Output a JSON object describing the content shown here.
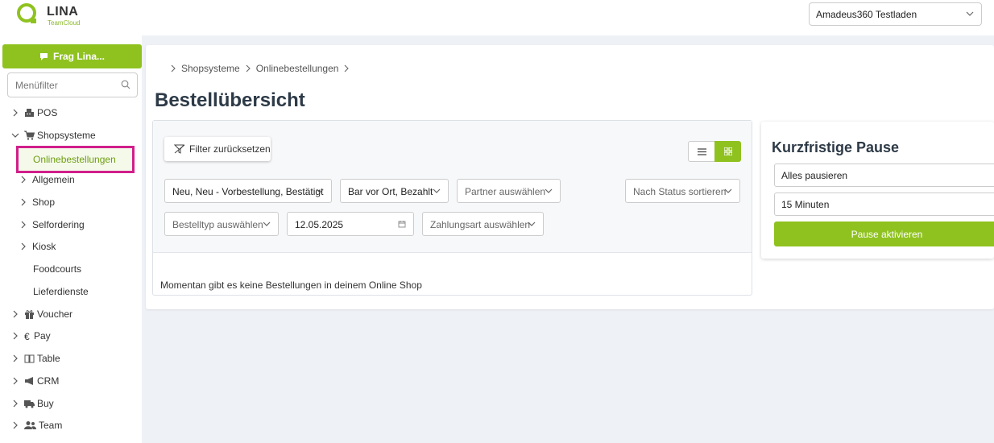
{
  "brand": {
    "name": "LINA",
    "sub": "TeamCloud",
    "accent": "#8fc21f",
    "highlight": "#d11e8b"
  },
  "header": {
    "store": "Amadeus360 Testladen"
  },
  "sidebar": {
    "frag_label": "Frag Lina...",
    "filter_placeholder": "Menüfilter",
    "items": [
      {
        "label": "POS",
        "icon": "cash-register-icon"
      },
      {
        "label": "Shopsysteme",
        "icon": "cart-icon"
      },
      {
        "label": "Onlinebestellungen"
      },
      {
        "label": "Allgemein"
      },
      {
        "label": "Shop"
      },
      {
        "label": "Selfordering"
      },
      {
        "label": "Kiosk"
      },
      {
        "label": "Foodcourts"
      },
      {
        "label": "Lieferdienste"
      },
      {
        "label": "Voucher",
        "icon": "gift-icon"
      },
      {
        "label": "Pay",
        "icon": "euro-icon"
      },
      {
        "label": "Table",
        "icon": "book-icon"
      },
      {
        "label": "CRM",
        "icon": "megaphone-icon"
      },
      {
        "label": "Buy",
        "icon": "truck-icon"
      },
      {
        "label": "Team",
        "icon": "users-icon"
      }
    ]
  },
  "breadcrumb": [
    "Shopsysteme",
    "Onlinebestellungen"
  ],
  "page_title": "Bestellübersicht",
  "filters": {
    "reset_label": "Filter zurücksetzen",
    "status": "Neu, Neu - Vorbestellung, Bestätigt",
    "payment_state": "Bar vor Ort, Bezahlt",
    "partner": "Partner auswählen",
    "sort": "Nach Status sortieren",
    "order_type": "Bestelltyp auswählen",
    "date": "12.05.2025",
    "payment_method": "Zahlungsart auswählen"
  },
  "empty_message": "Momentan gibt es keine Bestellungen in deinem Online Shop",
  "pause": {
    "title": "Kurzfristige Pause",
    "scope": "Alles pausieren",
    "duration": "15 Minuten",
    "button": "Pause aktivieren"
  }
}
